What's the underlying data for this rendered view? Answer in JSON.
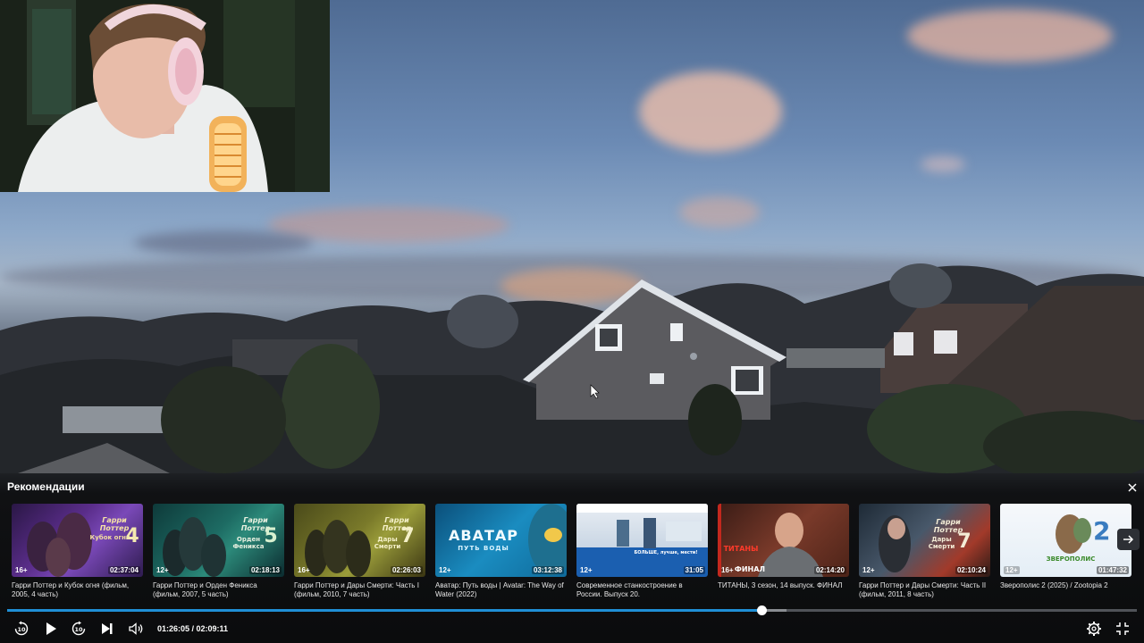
{
  "recommendations": {
    "title": "Рекомендации",
    "items": [
      {
        "title": "Гарри Поттер и Кубок огня (фильм, 2005, 4 часть)",
        "age": "16+",
        "duration": "02:37:04",
        "logo": "Гарри Поттер",
        "subtitle": "Кубок огня",
        "num": "4"
      },
      {
        "title": "Гарри Поттер и Орден Феникса (фильм, 2007, 5 часть)",
        "age": "12+",
        "duration": "02:18:13",
        "logo": "Гарри Поттер",
        "subtitle": "Орден Феникса",
        "num": "5"
      },
      {
        "title": "Гарри Поттер и Дары Смерти: Часть I (фильм, 2010, 7 часть)",
        "age": "16+",
        "duration": "02:26:03",
        "logo": "Гарри Поттер",
        "subtitle": "Дары Смерти",
        "num": "7"
      },
      {
        "title": "Аватар: Путь воды | Avatar: The Way of Water (2022)",
        "age": "12+",
        "duration": "03:12:38",
        "logo": "АВАТАР",
        "subtitle": "ПУТЬ ВОДЫ",
        "num": ""
      },
      {
        "title": "Современное станкостроение в России. Выпуск 20.",
        "age": "12+",
        "duration": "31:05",
        "logo": "БОЛЬШЕ, лучше, мести!",
        "subtitle": "",
        "num": ""
      },
      {
        "title": "ТИТАНЫ, 3 сезон, 14 выпуск. ФИНАЛ",
        "age": "16+",
        "duration": "02:14:20",
        "logo": "ТИТАНЫ",
        "subtitle": "ФИНАЛ",
        "num": ""
      },
      {
        "title": "Гарри Поттер и Дары Смерти: Часть II (фильм, 2011, 8 часть)",
        "age": "12+",
        "duration": "02:10:24",
        "logo": "Гарри Поттер",
        "subtitle": "Дары Смерти",
        "num": "7"
      },
      {
        "title": "Зверополис 2 (2025) / Zootopia 2",
        "age": "12+",
        "duration": "01:47:32",
        "logo": "ЗВЕРОПОЛИС",
        "subtitle": "",
        "num": "2"
      }
    ]
  },
  "player": {
    "time": "01:26:05 / 02:09:11",
    "progress": 0.668,
    "buffered": 0.69,
    "skip_back_label": "10",
    "skip_forward_label": "10"
  },
  "colors": {
    "accent": "#1f8fd6"
  }
}
